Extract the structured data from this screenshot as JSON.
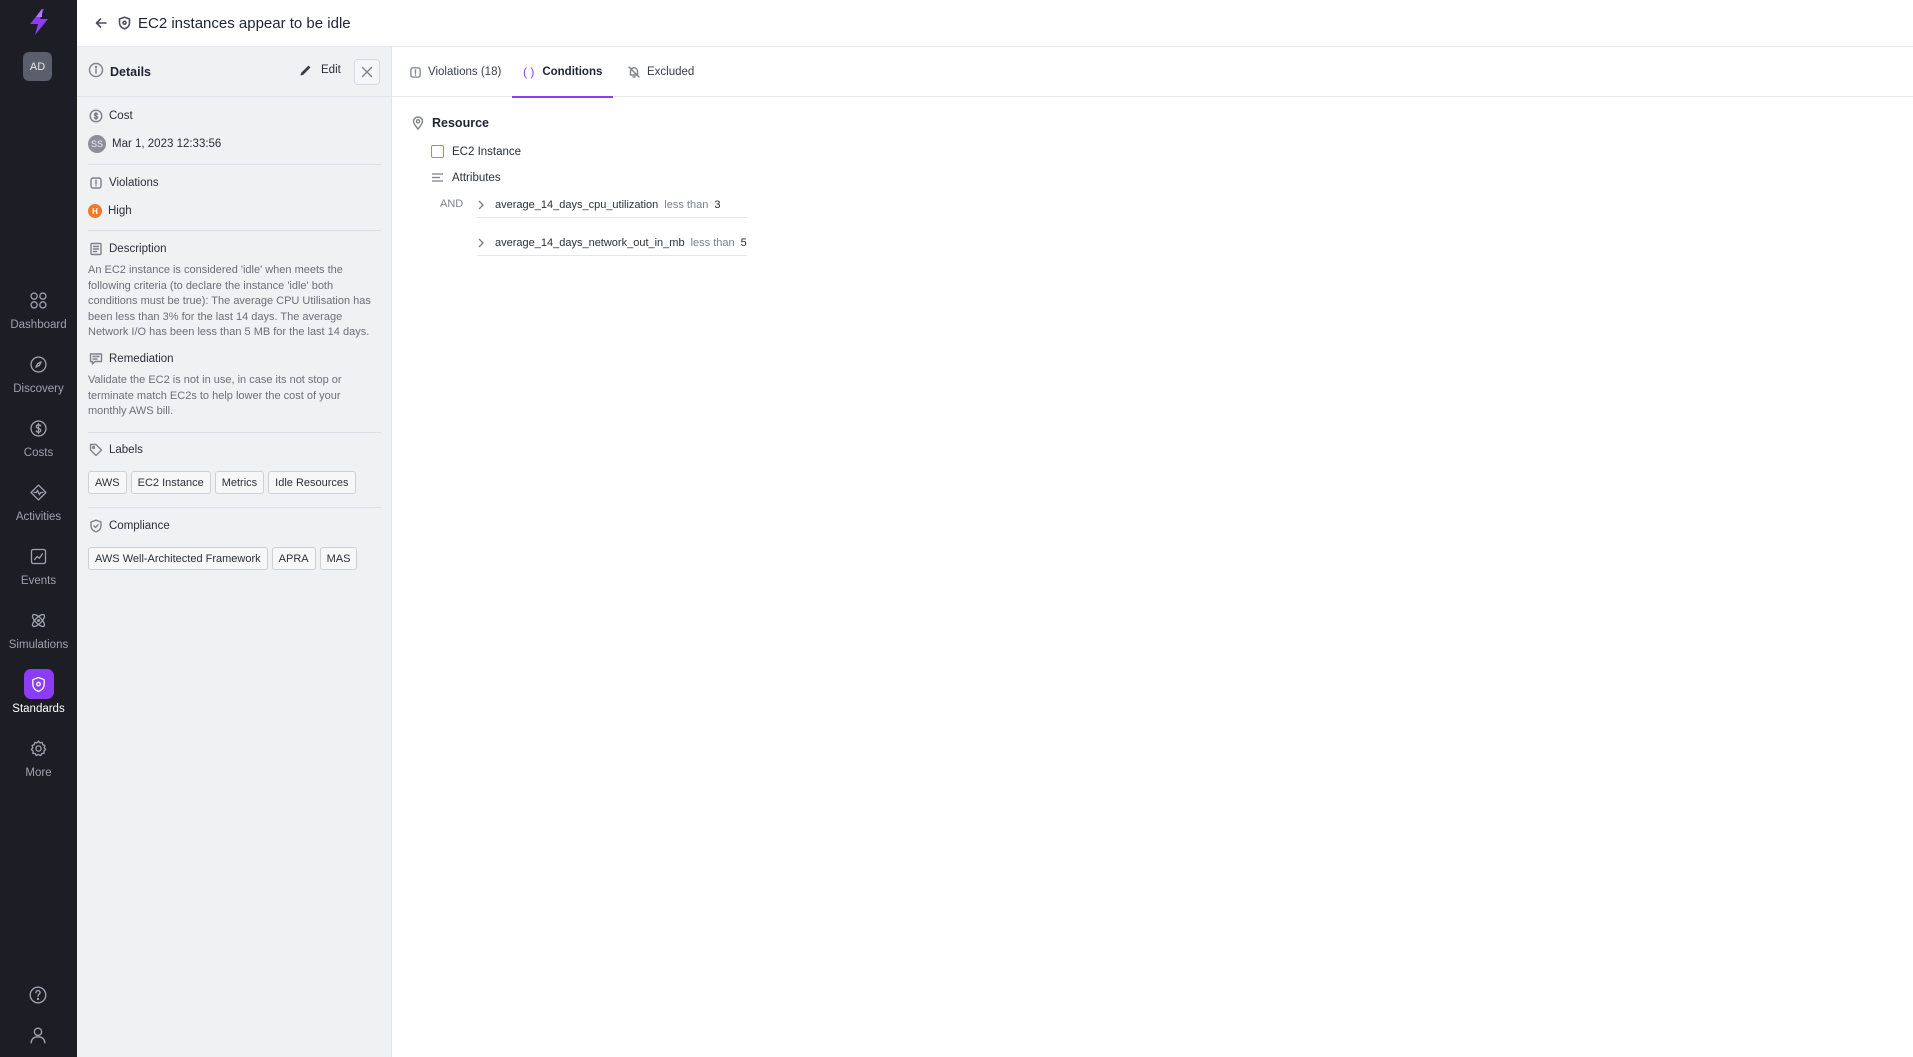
{
  "nav": {
    "avatar": "AD",
    "items": [
      {
        "label": "Dashboard",
        "icon": "dashboard-icon"
      },
      {
        "label": "Discovery",
        "icon": "compass-icon"
      },
      {
        "label": "Costs",
        "icon": "dollar-icon"
      },
      {
        "label": "Activities",
        "icon": "activity-icon"
      },
      {
        "label": "Events",
        "icon": "chart-icon"
      },
      {
        "label": "Simulations",
        "icon": "atom-icon"
      },
      {
        "label": "Standards",
        "icon": "shield-icon"
      },
      {
        "label": "More",
        "icon": "gear-icon"
      }
    ],
    "active": "Standards",
    "accent_color": "#8d3cf5"
  },
  "header": {
    "title": "EC2 instances appear to be idle"
  },
  "details": {
    "title": "Details",
    "edit_label": "Edit",
    "cost_label": "Cost",
    "user_initials": "SS",
    "timestamp": "Mar 1, 2023 12:33:56",
    "violations_label": "Violations",
    "severity_badge": "H",
    "severity": "High",
    "description_label": "Description",
    "description": "An EC2 instance is considered 'idle' when meets the following criteria (to declare the instance 'idle' both conditions must be true): The average CPU Utilisation has been less than 3% for the last 14 days. The average Network I/O has been less than 5 MB for the last 14 days.",
    "remediation_label": "Remediation",
    "remediation": "Validate the EC2 is not in use, in case its not stop or terminate match EC2s to help lower the cost of your monthly AWS bill.",
    "labels_label": "Labels",
    "labels": [
      "AWS",
      "EC2 Instance",
      "Metrics",
      "Idle Resources"
    ],
    "compliance_label": "Compliance",
    "compliance": [
      "AWS Well-Architected Framework",
      "APRA",
      "MAS"
    ]
  },
  "tabs": [
    {
      "label": "Violations (18)"
    },
    {
      "label": "Conditions"
    },
    {
      "label": "Excluded"
    }
  ],
  "conditions": {
    "resource_label": "Resource",
    "resource_type": "EC2 Instance",
    "attributes_label": "Attributes",
    "operator": "AND",
    "rows": [
      {
        "field": "average_14_days_cpu_utilization",
        "op": "less than",
        "value": "3"
      },
      {
        "field": "average_14_days_network_out_in_mb",
        "op": "less than",
        "value": "5"
      }
    ]
  }
}
